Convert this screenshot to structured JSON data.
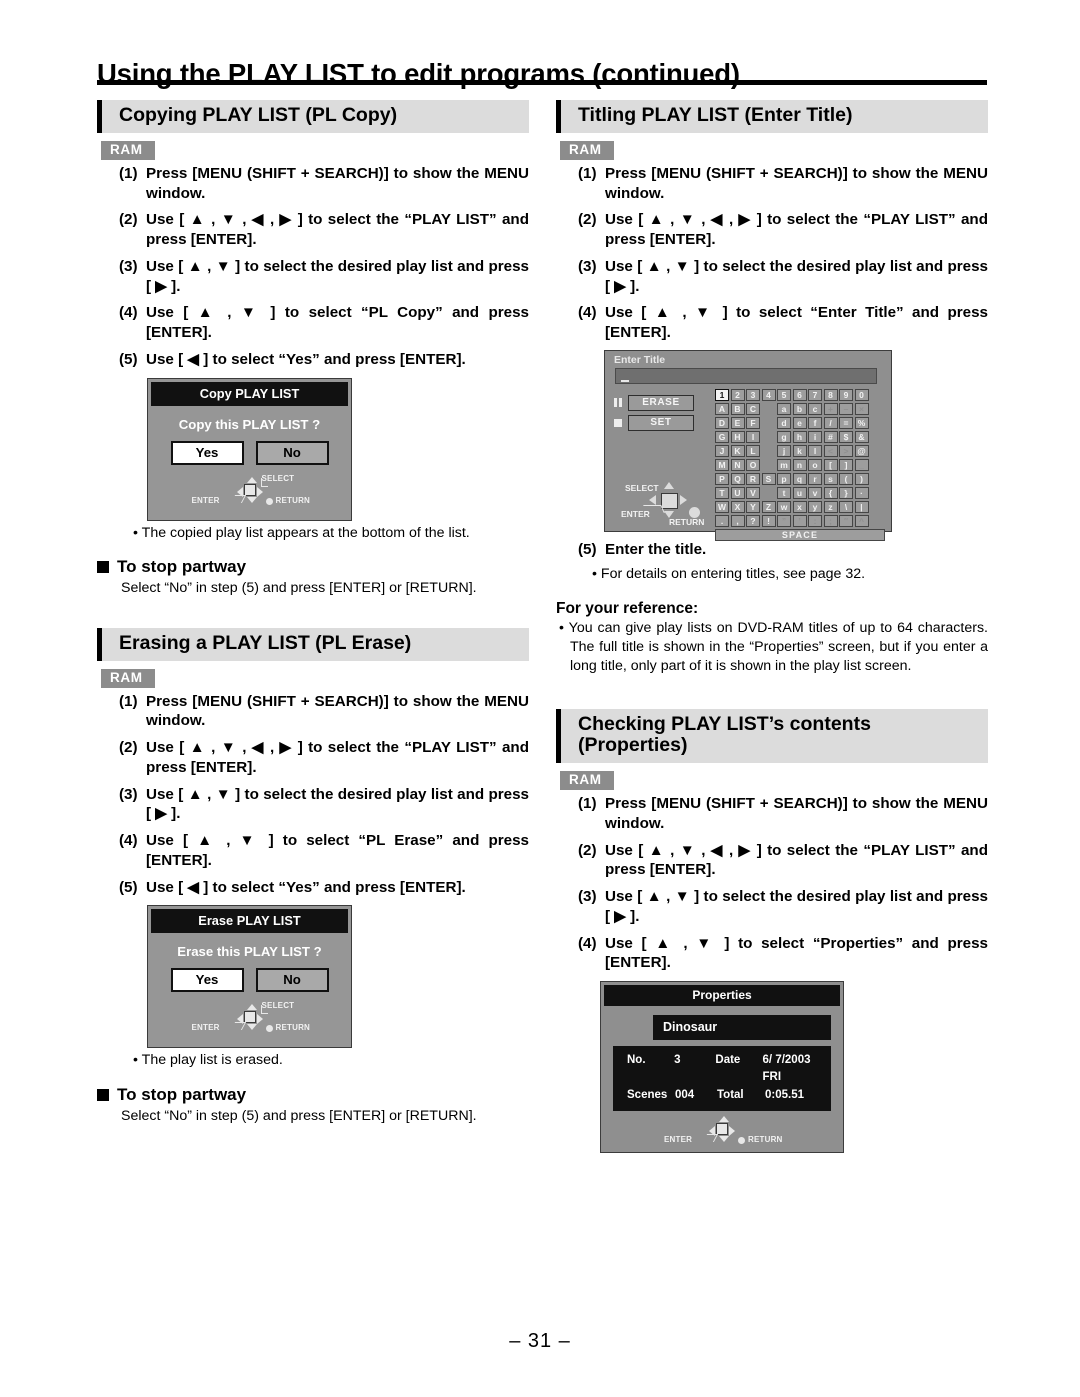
{
  "page": {
    "title": "Using the PLAY LIST to edit programs (continued)",
    "footer": "– 31 –"
  },
  "common": {
    "ram_badge": "RAM",
    "step1": "Press [MENU (SHIFT + SEARCH)] to show the MENU window.",
    "step2": "Use [ ▲ , ▼ , ◀ , ▶ ] to select the “PLAY LIST” and press [ENTER].",
    "step3": "Use [ ▲ , ▼ ] to select the desired play list and press [ ▶ ].",
    "n1": "(1)",
    "n2": "(2)",
    "n3": "(3)",
    "n4": "(4)",
    "n5": "(5)",
    "stop_partway_heading": "To stop partway",
    "stop_partway_text": "Select “No” in step (5) and press [ENTER] or [RETURN].",
    "yes_label": "Yes",
    "no_label": "No",
    "select_label": "SELECT",
    "enter_label": "ENTER",
    "return_label": "RETURN"
  },
  "copy_section": {
    "heading": "Copying PLAY LIST (PL Copy)",
    "step4": "Use [ ▲ , ▼ ] to select “PL Copy” and press [ENTER].",
    "step5": "Use [ ◀ ] to select “Yes” and press [ENTER].",
    "note": "• The copied play list appears at the bottom of the list.",
    "dialog": {
      "title": "Copy PLAY LIST",
      "question": "Copy this PLAY LIST ?"
    }
  },
  "erase_section": {
    "heading": "Erasing a PLAY LIST (PL Erase)",
    "step4": "Use [ ▲ , ▼ ] to select “PL Erase” and press [ENTER].",
    "step5": "Use [ ◀ ] to select “Yes” and press [ENTER].",
    "note": "• The play list is erased.",
    "dialog": {
      "title": "Erase PLAY LIST",
      "question": "Erase this PLAY LIST ?"
    }
  },
  "title_section": {
    "heading": "Titling PLAY LIST (Enter Title)",
    "step4": "Use [ ▲ , ▼ ] to select “Enter Title” and press [ENTER].",
    "step5": "Enter the title.",
    "note": "• For details on entering titles, see page 32.",
    "fyr_heading": "For your reference:",
    "fyr_text": "• You can give play lists on DVD-RAM titles of up to 64 characters. The full title is shown in the “Properties” screen, but if you enter a long title, only part of it is shown in the play list screen.",
    "enter_title_screen": {
      "title": "Enter Title",
      "input_value": "",
      "erase_button": "ERASE",
      "set_button": "SET",
      "space_key": "SPACE",
      "selected_key": "1",
      "keyboard_rows": [
        [
          "1",
          "2",
          "3",
          "4",
          "5",
          "6",
          "7",
          "8",
          "9",
          "0",
          ""
        ],
        [
          "A",
          "B",
          "C",
          "",
          "a",
          "b",
          "c",
          "+",
          "–",
          "×",
          ""
        ],
        [
          "D",
          "E",
          "F",
          "",
          "d",
          "e",
          "f",
          "/",
          "=",
          "%",
          ""
        ],
        [
          "G",
          "H",
          "I",
          "",
          "g",
          "h",
          "i",
          "#",
          "$",
          "&",
          ""
        ],
        [
          "J",
          "K",
          "L",
          "",
          "j",
          "k",
          "l",
          "<",
          ">",
          "@",
          ""
        ],
        [
          "M",
          "N",
          "O",
          "",
          "m",
          "n",
          "o",
          "[",
          "]",
          "_",
          ""
        ],
        [
          "P",
          "Q",
          "R",
          "S",
          "p",
          "q",
          "r",
          "s",
          "(",
          ")",
          ""
        ],
        [
          "T",
          "U",
          "V",
          "",
          "t",
          "u",
          "v",
          "{",
          "}",
          "·",
          ""
        ],
        [
          "W",
          "X",
          "Y",
          "Z",
          "w",
          "x",
          "y",
          "z",
          "\\",
          "|",
          ""
        ],
        [
          ".",
          ",",
          "?",
          "!",
          "”",
          "’",
          ":",
          ";",
          "″",
          "^",
          ""
        ]
      ]
    }
  },
  "properties_section": {
    "heading_line1": "Checking PLAY LIST’s contents",
    "heading_line2": "(Properties)",
    "step4": "Use [ ▲ , ▼ ] to select “Properties” and press [ENTER].",
    "dialog": {
      "title": "Properties",
      "name": "Dinosaur",
      "no_label": "No.",
      "no_value": "3",
      "date_label": "Date",
      "date_value": "6/ 7/2003 FRI",
      "scenes_label": "Scenes",
      "scenes_value": "004",
      "total_label": "Total",
      "total_value": "0:05.51"
    }
  }
}
